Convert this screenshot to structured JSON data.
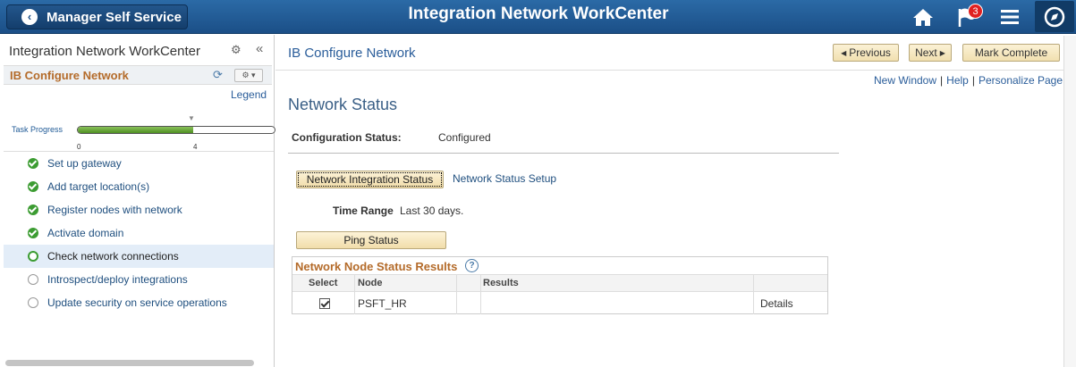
{
  "header": {
    "back_label": "Manager Self Service",
    "app_title": "Integration Network WorkCenter",
    "notification_count": "3",
    "icons": [
      "left-arrow-icon",
      "home-icon",
      "flag-icon",
      "hamburger-menu-icon",
      "navbar-compass-icon"
    ]
  },
  "left_panel": {
    "title": "Integration Network WorkCenter",
    "section_title": "IB Configure Network",
    "legend_label": "Legend",
    "progress": {
      "label": "Task Progress",
      "min_label": "0",
      "max_label": "4",
      "completed_fraction": 0.585
    },
    "tasks": [
      {
        "label": "Set up gateway",
        "state": "done"
      },
      {
        "label": "Add target location(s)",
        "state": "done"
      },
      {
        "label": "Register nodes with network",
        "state": "done"
      },
      {
        "label": "Activate domain",
        "state": "done"
      },
      {
        "label": "Check network connections",
        "state": "current"
      },
      {
        "label": "Introspect/deploy integrations",
        "state": "todo"
      },
      {
        "label": "Update security on service operations",
        "state": "todo"
      }
    ]
  },
  "main": {
    "page_title": "IB Configure Network",
    "buttons": {
      "previous": "Previous",
      "next": "Next",
      "mark_complete": "Mark Complete"
    },
    "utility_links": [
      "New Window",
      "Help",
      "Personalize Page"
    ],
    "section_title": "Network Status",
    "config_status_label": "Configuration Status:",
    "config_status_value": "Configured",
    "network_integration_status_button": "Network Integration Status",
    "network_status_setup_link": "Network Status Setup",
    "time_range_label": "Time Range",
    "time_range_value": "Last 30 days.",
    "ping_button": "Ping Status",
    "grid": {
      "title": "Network Node Status Results",
      "help": "?",
      "columns": [
        "Select",
        "Node",
        "",
        "Results",
        ""
      ],
      "rows": [
        {
          "selected": true,
          "node": "PSFT_HR",
          "results": "",
          "details": "Details"
        }
      ]
    }
  },
  "colors": {
    "header_blue": "#1b4f87",
    "section_orange": "#b46b2a",
    "link_blue": "#2a5d9a",
    "complete_green": "#3c9c32",
    "badge_red": "#e02020"
  }
}
